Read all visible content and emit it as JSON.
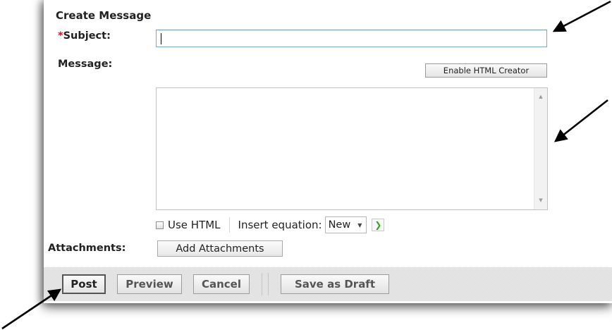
{
  "form": {
    "title": "Create Message",
    "required_marker": "*",
    "subject_label": "Subject:",
    "subject_value": "",
    "message_label": "Message:",
    "enable_html_creator_label": "Enable HTML Creator",
    "message_value": "",
    "use_html_label": "Use HTML",
    "use_html_checked": false,
    "insert_equation_label": "Insert equation:",
    "equation_selected": "New",
    "attachments_label": "Attachments:",
    "add_attachments_label": "Add Attachments"
  },
  "footer": {
    "post_label": "Post",
    "preview_label": "Preview",
    "cancel_label": "Cancel",
    "save_draft_label": "Save as Draft"
  },
  "icons": {
    "dropdown": "chevron-down-icon",
    "go": "green-chevron-right-icon",
    "scroll_up": "scroll-up-icon",
    "scroll_down": "scroll-down-icon"
  },
  "colors": {
    "required": "#d0121e",
    "go_arrow": "#3a9e1e",
    "input_border": "#7fa7c8"
  }
}
